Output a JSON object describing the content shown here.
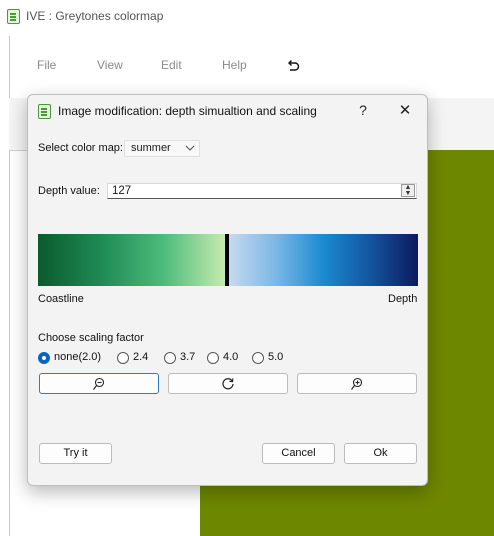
{
  "window": {
    "title": "IVE : Greytones colormap",
    "icon": "app-icon"
  },
  "menu": {
    "items": [
      "File",
      "View",
      "Edit",
      "Help"
    ],
    "undo_icon": "undo-icon"
  },
  "canvas": {
    "color": "#6e8700"
  },
  "dialog": {
    "title": "Image modification: depth simualtion and scaling",
    "help_label": "?",
    "close_label": "✕",
    "colormap": {
      "label": "Select color map:",
      "value": "summer"
    },
    "depth": {
      "label": "Depth value:",
      "value": "127"
    },
    "gradient": {
      "left_label": "Coastline",
      "right_label": "Depth",
      "left_colors": [
        "#0b5a2d",
        "#1f8a55",
        "#4cbb7a",
        "#c8ecb0"
      ],
      "right_colors": [
        "#c6d9ef",
        "#7bb7e5",
        "#1b8ad0",
        "#13559f",
        "#0c1a5e"
      ]
    },
    "scaling": {
      "label": "Choose scaling factor",
      "options": [
        "none(2.0)",
        "2.4",
        "3.7",
        "4.0",
        "5.0"
      ],
      "selected": "none(2.0)"
    },
    "zoom_buttons": [
      "zoom-out-icon",
      "reset-icon",
      "zoom-in-icon"
    ],
    "buttons": {
      "try": "Try it",
      "cancel": "Cancel",
      "ok": "Ok"
    }
  }
}
